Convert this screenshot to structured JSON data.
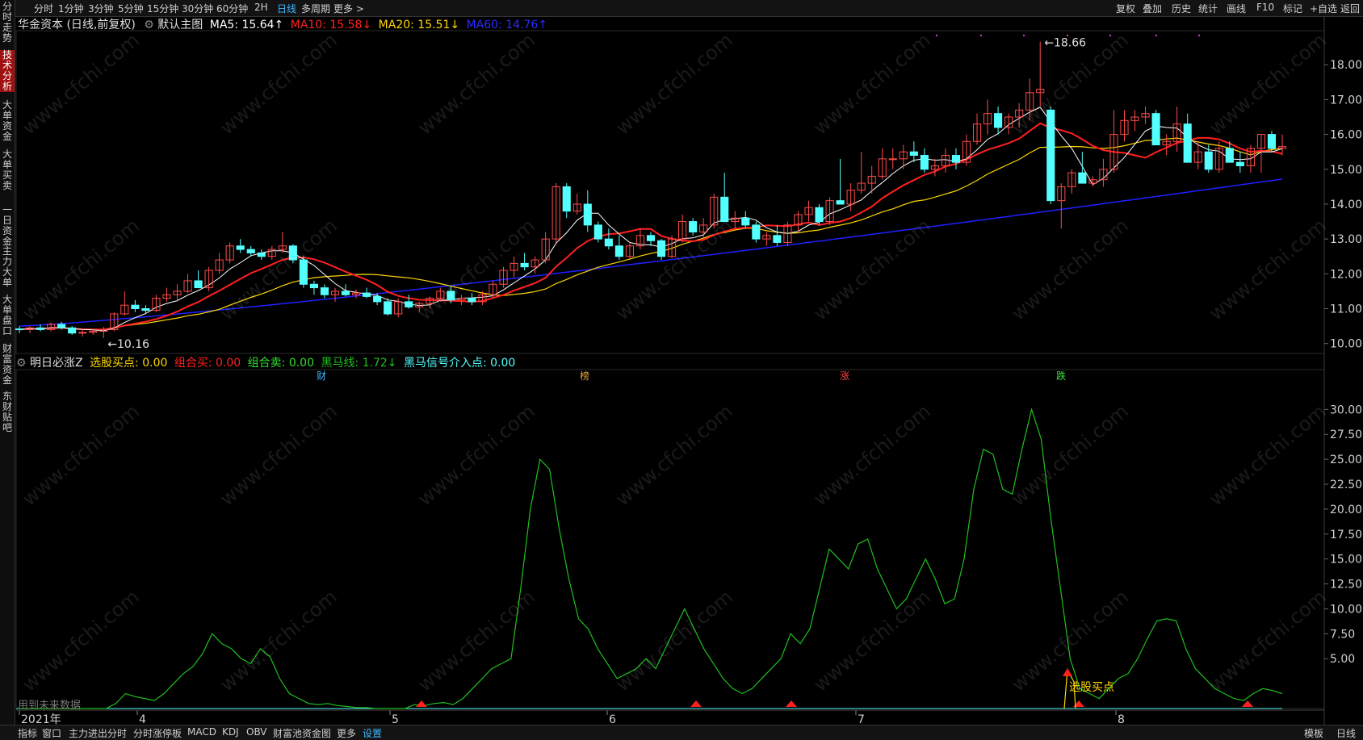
{
  "top_tabs": [
    "分时",
    "1分钟",
    "3分钟",
    "5分钟",
    "15分钟",
    "30分钟",
    "60分钟",
    "2H",
    "日线",
    "多周期",
    "更多 >"
  ],
  "active_tab": "日线",
  "right_tabs": [
    "复权",
    "叠加",
    "历史",
    "统计",
    "画线",
    "F10",
    "标记",
    "+自选",
    "返回"
  ],
  "left_nav": [
    "分时走势",
    "技术分析",
    "大单资金",
    "大单买卖",
    "一日资金",
    "主力大单",
    "大单盘口",
    "财富资金",
    "东财贴吧"
  ],
  "left_nav_active": 1,
  "main_legend": {
    "stock": "华金资本 (日线,前复权)",
    "template": "默认主图",
    "ma5": "MA5: 15.64↑",
    "ma10": "MA10: 15.58↓",
    "ma20": "MA20: 15.51↓",
    "ma60": "MA60: 14.76↑"
  },
  "sub_legend": {
    "name": "明日必涨Z",
    "buy": "选股买点: 0.00",
    "combo_buy": "组合买: 0.00",
    "combo_sell": "组合卖: 0.00",
    "dark_horse": "黑马线: 1.72↓",
    "dark_signal": "黑马信号介入点: 0.00"
  },
  "price_axis": [
    "18.00",
    "17.00",
    "16.00",
    "15.00",
    "14.00",
    "13.00",
    "12.00",
    "11.00",
    "10.00"
  ],
  "ind_axis": [
    "30.00",
    "27.50",
    "25.00",
    "22.50",
    "20.00",
    "17.50",
    "15.00",
    "12.50",
    "10.00",
    "7.50",
    "5.00"
  ],
  "annotations": {
    "high": "18.66",
    "low": "10.16",
    "buy_point": "选股买点",
    "future_data": "用到未来数据"
  },
  "event_markers": [
    {
      "label": "财",
      "color": "#3fb8ff"
    },
    {
      "label": "榜",
      "color": "#e6a23c"
    },
    {
      "label": "涨",
      "color": "#ff4040"
    },
    {
      "label": "跌",
      "color": "#40e040"
    }
  ],
  "date_axis": [
    "2021年",
    "4",
    "5",
    "6",
    "7",
    "8"
  ],
  "bottom_tabs": [
    "指标",
    "窗口",
    "主力进出分时",
    "分时涨停板",
    "MACD",
    "KDJ",
    "OBV",
    "财富池资金图",
    "更多",
    "设置"
  ],
  "bottom_right": [
    "模板",
    "日线"
  ],
  "watermark": "www.cfchi.com",
  "colors": {
    "up": "#ff4a4a",
    "down": "#54ffff",
    "ma5": "#ffffff",
    "ma10": "#ff2020",
    "ma20": "#ffd700",
    "ma60": "#2020ff",
    "indicator": "#1fbf1f"
  },
  "chart_data": [
    {
      "type": "candlestick",
      "title": "华金资本 日线",
      "ylim": [
        10.0,
        18.66
      ],
      "ohlc": [
        [
          10.42,
          10.5,
          10.3,
          10.4
        ],
        [
          10.4,
          10.5,
          10.3,
          10.45
        ],
        [
          10.45,
          10.55,
          10.35,
          10.4
        ],
        [
          10.4,
          10.6,
          10.35,
          10.55
        ],
        [
          10.55,
          10.62,
          10.4,
          10.45
        ],
        [
          10.45,
          10.5,
          10.25,
          10.3
        ],
        [
          10.3,
          10.4,
          10.2,
          10.32
        ],
        [
          10.32,
          10.42,
          10.25,
          10.35
        ],
        [
          10.35,
          10.48,
          10.16,
          10.4
        ],
        [
          10.4,
          10.9,
          10.35,
          10.85
        ],
        [
          10.85,
          11.5,
          10.8,
          11.1
        ],
        [
          11.1,
          11.25,
          10.9,
          11.0
        ],
        [
          11.0,
          11.1,
          10.85,
          10.95
        ],
        [
          10.95,
          11.4,
          10.9,
          11.3
        ],
        [
          11.3,
          11.6,
          11.2,
          11.4
        ],
        [
          11.4,
          11.7,
          11.2,
          11.5
        ],
        [
          11.5,
          12.0,
          11.45,
          11.8
        ],
        [
          11.8,
          12.1,
          11.6,
          11.6
        ],
        [
          11.6,
          12.2,
          11.5,
          12.1
        ],
        [
          12.1,
          12.6,
          12.0,
          12.4
        ],
        [
          12.4,
          12.9,
          12.3,
          12.8
        ],
        [
          12.8,
          13.0,
          12.6,
          12.7
        ],
        [
          12.7,
          12.8,
          12.5,
          12.6
        ],
        [
          12.6,
          12.7,
          12.4,
          12.5
        ],
        [
          12.5,
          12.8,
          12.4,
          12.7
        ],
        [
          12.7,
          13.2,
          12.6,
          12.8
        ],
        [
          12.8,
          12.85,
          12.3,
          12.4
        ],
        [
          12.4,
          12.5,
          11.6,
          11.7
        ],
        [
          11.7,
          11.8,
          11.4,
          11.6
        ],
        [
          11.6,
          11.7,
          11.3,
          11.4
        ],
        [
          11.4,
          11.6,
          11.2,
          11.5
        ],
        [
          11.5,
          11.7,
          11.35,
          11.4
        ],
        [
          11.4,
          11.55,
          11.3,
          11.45
        ],
        [
          11.45,
          11.6,
          11.3,
          11.35
        ],
        [
          11.35,
          11.45,
          11.1,
          11.2
        ],
        [
          11.2,
          11.3,
          10.8,
          10.85
        ],
        [
          10.85,
          11.3,
          10.75,
          11.2
        ],
        [
          11.2,
          11.4,
          11.0,
          11.05
        ],
        [
          11.05,
          11.2,
          10.9,
          11.15
        ],
        [
          11.15,
          11.35,
          11.0,
          11.3
        ],
        [
          11.3,
          11.6,
          11.2,
          11.5
        ],
        [
          11.5,
          11.65,
          11.15,
          11.25
        ],
        [
          11.25,
          11.4,
          11.1,
          11.3
        ],
        [
          11.3,
          11.45,
          11.1,
          11.2
        ],
        [
          11.2,
          11.5,
          11.1,
          11.4
        ],
        [
          11.4,
          11.8,
          11.3,
          11.7
        ],
        [
          11.7,
          12.2,
          11.6,
          12.1
        ],
        [
          12.1,
          12.5,
          11.9,
          12.3
        ],
        [
          12.3,
          12.6,
          12.1,
          12.2
        ],
        [
          12.2,
          12.5,
          12.0,
          12.4
        ],
        [
          12.4,
          13.2,
          12.3,
          13.0
        ],
        [
          13.0,
          14.6,
          12.9,
          14.5
        ],
        [
          14.5,
          14.6,
          13.6,
          13.8
        ],
        [
          13.8,
          14.3,
          13.7,
          14.0
        ],
        [
          14.0,
          14.4,
          13.2,
          13.4
        ],
        [
          13.4,
          13.5,
          12.9,
          13.0
        ],
        [
          13.0,
          13.3,
          12.7,
          12.8
        ],
        [
          12.8,
          13.1,
          12.4,
          12.5
        ],
        [
          12.5,
          12.9,
          12.4,
          12.8
        ],
        [
          12.8,
          13.3,
          12.7,
          13.1
        ],
        [
          13.1,
          13.2,
          12.8,
          12.95
        ],
        [
          12.95,
          13.0,
          12.4,
          12.5
        ],
        [
          12.5,
          13.1,
          12.45,
          13.0
        ],
        [
          13.0,
          13.7,
          12.9,
          13.5
        ],
        [
          13.5,
          13.6,
          13.1,
          13.2
        ],
        [
          13.2,
          13.6,
          13.0,
          13.4
        ],
        [
          13.4,
          14.3,
          13.3,
          14.2
        ],
        [
          14.2,
          14.9,
          13.8,
          13.5
        ],
        [
          13.5,
          13.8,
          13.3,
          13.6
        ],
        [
          13.6,
          13.8,
          13.3,
          13.4
        ],
        [
          13.4,
          13.5,
          12.9,
          13.0
        ],
        [
          13.0,
          13.2,
          12.8,
          13.1
        ],
        [
          13.1,
          13.4,
          12.8,
          12.9
        ],
        [
          12.9,
          13.5,
          12.8,
          13.4
        ],
        [
          13.4,
          13.8,
          13.2,
          13.7
        ],
        [
          13.7,
          14.1,
          13.5,
          13.9
        ],
        [
          13.9,
          14.0,
          13.4,
          13.5
        ],
        [
          13.5,
          14.2,
          13.4,
          14.1
        ],
        [
          14.1,
          15.3,
          14.0,
          14.0
        ],
        [
          14.0,
          14.6,
          13.8,
          14.4
        ],
        [
          14.4,
          15.5,
          14.3,
          14.6
        ],
        [
          14.6,
          15.1,
          14.3,
          14.8
        ],
        [
          14.8,
          15.6,
          14.7,
          15.3
        ],
        [
          15.3,
          15.6,
          15.0,
          15.3
        ],
        [
          15.3,
          15.7,
          15.0,
          15.5
        ],
        [
          15.5,
          15.8,
          15.2,
          15.4
        ],
        [
          15.4,
          15.6,
          14.9,
          15.0
        ],
        [
          15.0,
          15.3,
          14.8,
          15.1
        ],
        [
          15.1,
          15.6,
          14.9,
          15.4
        ],
        [
          15.4,
          15.6,
          15.0,
          15.2
        ],
        [
          15.2,
          16.0,
          15.1,
          15.8
        ],
        [
          15.8,
          16.6,
          15.7,
          16.3
        ],
        [
          16.3,
          17.0,
          16.0,
          16.6
        ],
        [
          16.6,
          16.8,
          16.0,
          16.2
        ],
        [
          16.2,
          16.6,
          16.0,
          16.5
        ],
        [
          16.5,
          16.9,
          16.2,
          16.7
        ],
        [
          16.7,
          17.6,
          16.4,
          17.2
        ],
        [
          17.2,
          18.66,
          16.8,
          17.3
        ],
        [
          16.7,
          16.8,
          14.0,
          14.1
        ],
        [
          14.1,
          14.6,
          13.3,
          14.5
        ],
        [
          14.5,
          15.0,
          14.3,
          14.9
        ],
        [
          14.9,
          15.5,
          14.6,
          14.6
        ],
        [
          14.6,
          14.8,
          14.5,
          14.7
        ],
        [
          14.7,
          15.3,
          14.5,
          15.0
        ],
        [
          15.0,
          16.7,
          14.9,
          16.0
        ],
        [
          16.0,
          16.7,
          15.8,
          16.4
        ],
        [
          16.4,
          16.7,
          16.1,
          16.5
        ],
        [
          16.5,
          16.8,
          16.3,
          16.6
        ],
        [
          16.6,
          16.7,
          15.7,
          15.7
        ],
        [
          15.7,
          16.0,
          15.4,
          15.8
        ],
        [
          15.8,
          16.8,
          15.5,
          16.3
        ],
        [
          16.3,
          16.6,
          15.2,
          15.2
        ],
        [
          15.2,
          15.8,
          15.0,
          15.5
        ],
        [
          15.5,
          15.7,
          14.9,
          15.0
        ],
        [
          15.0,
          15.8,
          14.9,
          15.6
        ],
        [
          15.6,
          15.8,
          15.2,
          15.2
        ],
        [
          15.2,
          15.5,
          14.9,
          15.1
        ],
        [
          15.1,
          15.7,
          14.9,
          15.6
        ],
        [
          15.6,
          16.0,
          14.9,
          16.0
        ],
        [
          16.0,
          16.1,
          15.5,
          15.6
        ],
        [
          15.6,
          16.0,
          15.4,
          15.65
        ]
      ],
      "ma60_range": [
        10.5,
        14.72
      ]
    },
    {
      "type": "line",
      "series_name": "黑马线",
      "ylim": [
        0,
        30
      ],
      "values": [
        0,
        0,
        0,
        0,
        0,
        0,
        0,
        0,
        0,
        0,
        0.5,
        1.5,
        1.2,
        1.0,
        0.8,
        1.5,
        2.5,
        3.5,
        4.2,
        5.5,
        7.5,
        6.5,
        6.0,
        5.0,
        4.5,
        6.0,
        5.2,
        3.0,
        1.5,
        1.0,
        0.5,
        0.4,
        0.5,
        0.3,
        0.2,
        0.1,
        0.1,
        0,
        0,
        0,
        0,
        0.4,
        0.3,
        0.5,
        0.6,
        0.4,
        1.0,
        2.0,
        3.0,
        4.0,
        4.5,
        5.0,
        12.0,
        20.0,
        25.0,
        24.0,
        18.0,
        13.0,
        9.0,
        8.0,
        6.0,
        4.5,
        3.0,
        3.5,
        4.0,
        5.0,
        4.0,
        6.0,
        8.0,
        10.0,
        8.0,
        6.0,
        4.5,
        3.0,
        2.0,
        1.5,
        2.0,
        3.0,
        4.0,
        5.0,
        7.5,
        6.5,
        8.0,
        12.0,
        16.0,
        15.0,
        14.0,
        16.5,
        17.0,
        14.0,
        12.0,
        10.0,
        11.0,
        13.0,
        15.0,
        13.0,
        10.5,
        11.0,
        15.0,
        22.0,
        26.0,
        25.5,
        22.0,
        21.5,
        26.0,
        30.0,
        27.0,
        19.0,
        12.0,
        5.0,
        2.0,
        1.5,
        1.0,
        2.0,
        3.0,
        3.5,
        5.0,
        7.0,
        8.8,
        9.0,
        8.8,
        6.0,
        4.0,
        3.0,
        2.0,
        1.5,
        1.0,
        0.8,
        1.5,
        2.0,
        1.8,
        1.5
      ]
    }
  ]
}
